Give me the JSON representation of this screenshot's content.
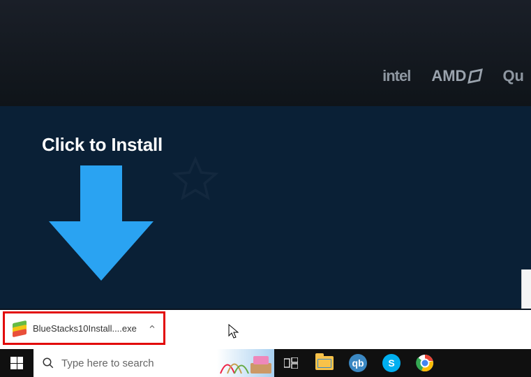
{
  "hero": {
    "partners": {
      "intel": "intel",
      "amd": "AMD",
      "q": "Qu"
    }
  },
  "install": {
    "heading": "Click to Install"
  },
  "download": {
    "filename": "BlueStacks10Install....exe"
  },
  "taskbar": {
    "search_placeholder": "Type here to search",
    "apps": {
      "qb_label": "qb",
      "skype_label": "S"
    }
  },
  "colors": {
    "arrow": "#2aa3f2",
    "highlight": "#e20808"
  }
}
